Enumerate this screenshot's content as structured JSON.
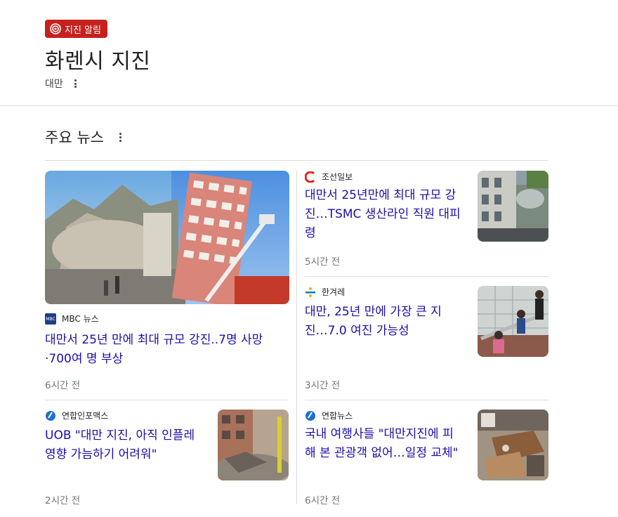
{
  "header": {
    "alert_badge": "지진 알림",
    "title": "화렌시 지진",
    "location": "대만"
  },
  "section": {
    "title": "주요 뉴스"
  },
  "articles": [
    {
      "source": "MBC 뉴스",
      "headline": "대만서 25년 만에 최대 규모 강진..7명 사망·700여 명 부상",
      "time": "6시간 전"
    },
    {
      "source": "조선일보",
      "headline": "대만서 25년만에 최대 규모 강진…TSMC 생산라인 직원 대피령",
      "time": "5시간 전"
    },
    {
      "source": "한겨레",
      "headline": "대만, 25년 만에 가장 큰 지진…7.0 여진 가능성",
      "time": "3시간 전"
    },
    {
      "source": "연합인포맥스",
      "headline": "UOB \"대만 지진, 아직 인플레 영향 가늠하기 어려워\"",
      "time": "2시간 전"
    },
    {
      "source": "연합뉴스",
      "headline": "국내 여행사들 \"대만지진에 피해 본 관광객 없어…일정 교체\"",
      "time": "6시간 전"
    }
  ],
  "colors": {
    "alert_red": "#c5221f",
    "link_blue": "#1a0dab",
    "muted_gray": "#70757a"
  },
  "icons": [
    "earthquake-alert-icon",
    "more-options-icon",
    "mbc-logo-icon",
    "chosun-logo-icon",
    "hani-logo-icon",
    "yonhap-infomax-logo-icon",
    "yonhap-logo-icon"
  ]
}
